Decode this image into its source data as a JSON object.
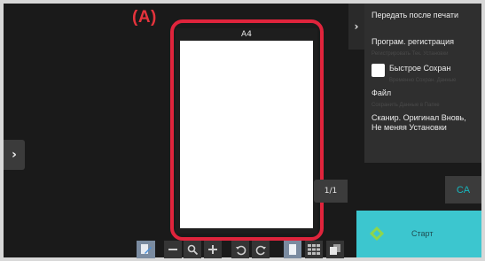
{
  "callout_label": "(A)",
  "preview": {
    "paper_size": "A4",
    "page_counter": "1/1"
  },
  "side_panel": {
    "items": [
      {
        "label": "Передать после печати"
      },
      {
        "label": "Програм. регистрация",
        "sub": "Регистрировать Тек. Установки"
      },
      {
        "label": "Быстрое Сохран",
        "sub": "Временно Сохран. Данные"
      },
      {
        "label": "Файл",
        "sub": "Сохранить Данные в Папке"
      },
      {
        "label": "Сканир. Оригинал Вновь, Не меняя Установки"
      }
    ]
  },
  "buttons": {
    "ca": "CA",
    "start": "Старт"
  },
  "colors": {
    "accent": "#3cc6cf",
    "highlight": "#e0243c",
    "ca_text": "#17b6bd"
  },
  "toolbar_icons": [
    "edit-icon",
    "zoom-out-icon",
    "zoom-icon",
    "zoom-in-icon",
    "rotate-left-icon",
    "rotate-right-icon",
    "single-page-icon",
    "thumbnail-grid-icon",
    "multi-page-icon"
  ]
}
